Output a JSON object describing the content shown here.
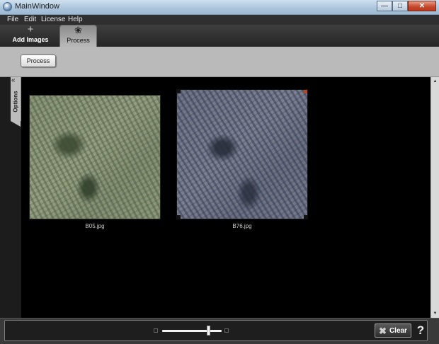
{
  "window": {
    "title": "MainWindow"
  },
  "menu": {
    "items": [
      "File",
      "Edit",
      "License",
      "Help"
    ]
  },
  "ribbon": {
    "tabs": [
      {
        "label": "Add Images",
        "icon": "plus-icon"
      },
      {
        "label": "Process",
        "icon": "flower-icon",
        "active": true
      }
    ]
  },
  "actionbar": {
    "process_label": "Process"
  },
  "options": {
    "label": "Options",
    "collapse_glyph": "«"
  },
  "images": [
    {
      "caption": "B05.jpg"
    },
    {
      "caption": "B76.jpg"
    }
  ],
  "bottombar": {
    "zoom_level": 0.78,
    "clear_label": "Clear",
    "help_glyph": "?"
  },
  "colors": {
    "menubar": "#2f2f2f",
    "actionbar": "#bababa",
    "canvas": "#000000"
  }
}
